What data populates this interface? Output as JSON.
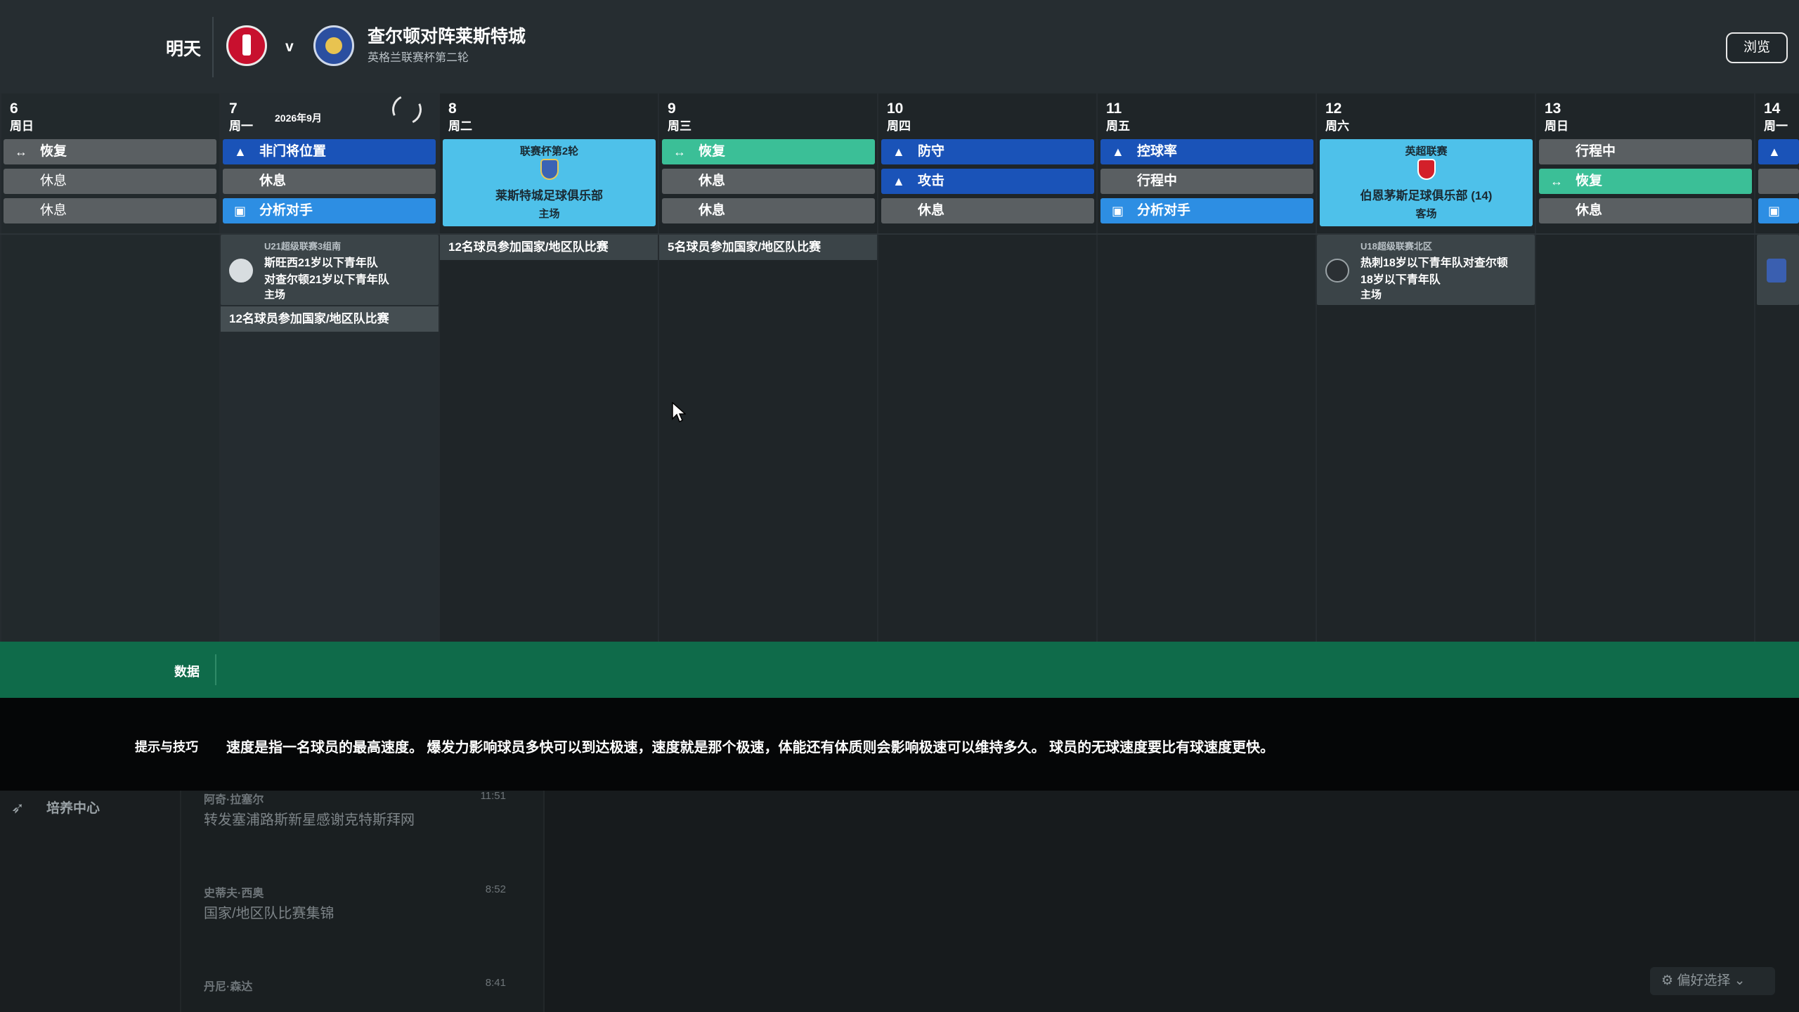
{
  "header": {
    "when": "明天",
    "vs": "v",
    "title": "查尔顿对阵莱斯特城",
    "subtitle": "英格兰联赛杯第二轮",
    "browse_label": "浏览"
  },
  "calendar": {
    "month_label": "2026年9月",
    "days": [
      {
        "num": "6",
        "weekday": "周日"
      },
      {
        "num": "7",
        "weekday": "周一"
      },
      {
        "num": "8",
        "weekday": "周二"
      },
      {
        "num": "9",
        "weekday": "周三"
      },
      {
        "num": "10",
        "weekday": "周四"
      },
      {
        "num": "11",
        "weekday": "周五"
      },
      {
        "num": "12",
        "weekday": "周六"
      },
      {
        "num": "13",
        "weekday": "周日"
      },
      {
        "num": "14",
        "weekday": "周一"
      }
    ],
    "activities": {
      "d6": [
        "恢复",
        "休息",
        "休息"
      ],
      "d7": [
        "非门将位置",
        "休息",
        "分析对手"
      ],
      "d9": [
        "恢复",
        "休息",
        "休息"
      ],
      "d10": [
        "防守",
        "攻击",
        "休息"
      ],
      "d11": [
        "控球率",
        "行程中",
        "分析对手"
      ],
      "d13": [
        "行程中",
        "恢复",
        "休息"
      ]
    },
    "match_d8": {
      "competition": "联赛杯第2轮",
      "opponent": "莱斯特城足球俱乐部",
      "venue": "主场"
    },
    "match_d12": {
      "competition": "英超联赛",
      "opponent": "伯恩茅斯足球俱乐部 (14)",
      "venue": "客场"
    },
    "u21_event": {
      "competition": "U21超级联赛3组南",
      "line1": "斯旺西21岁以下青年队",
      "line2": "对查尔顿21岁以下青年队",
      "venue": "主场"
    },
    "u18_event": {
      "competition": "U18超级联赛北区",
      "line1": "热刺18岁以下青年队对查尔顿",
      "line2": "18岁以下青年队",
      "venue": "主场"
    },
    "intl": {
      "d7": "12名球员参加国家/地区队比赛",
      "d8": "12名球员参加国家/地区队比赛",
      "d9": "5名球员参加国家/地区队比赛"
    }
  },
  "data_strip": {
    "label": "数据"
  },
  "tips": {
    "label": "提示与技巧",
    "text": "速度是指一名球员的最高速度。 爆发力影响球员多快可以到达极速，速度就是那个极速，体能还有体质则会影响极速可以维持多久。 球员的无球速度要比有球速度更快。"
  },
  "inbox": {
    "category": "培养中心",
    "messages": [
      {
        "from": "阿奇·拉塞尔",
        "time": "11:51",
        "subject": "转发塞浦路斯新星感谢克特斯拜网"
      },
      {
        "from": "史蒂夫·西奥",
        "time": "8:52",
        "subject": "国家/地区队比赛集锦"
      },
      {
        "from": "丹尼·森达",
        "time": "8:41",
        "subject": ""
      }
    ]
  },
  "prefs_label": "偏好选择"
}
